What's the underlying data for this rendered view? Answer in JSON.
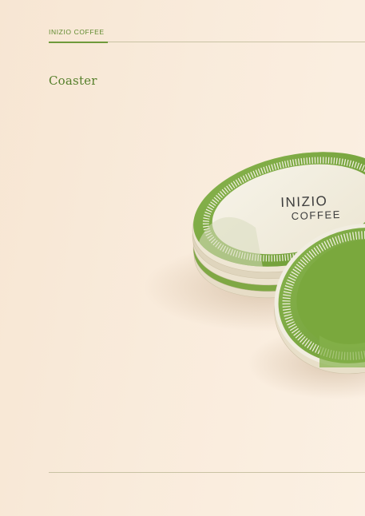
{
  "header": {
    "brand": "INIZIO COFFEE"
  },
  "section": {
    "title": "Coaster"
  },
  "mockup": {
    "logo_line1": "INIZIO",
    "logo_line2": "COFFEE"
  },
  "colors": {
    "background": "#f8e8d6",
    "accent_green": "#6f9a3b",
    "coaster_green": "#79a83f",
    "coaster_cream": "#f3efe2"
  }
}
